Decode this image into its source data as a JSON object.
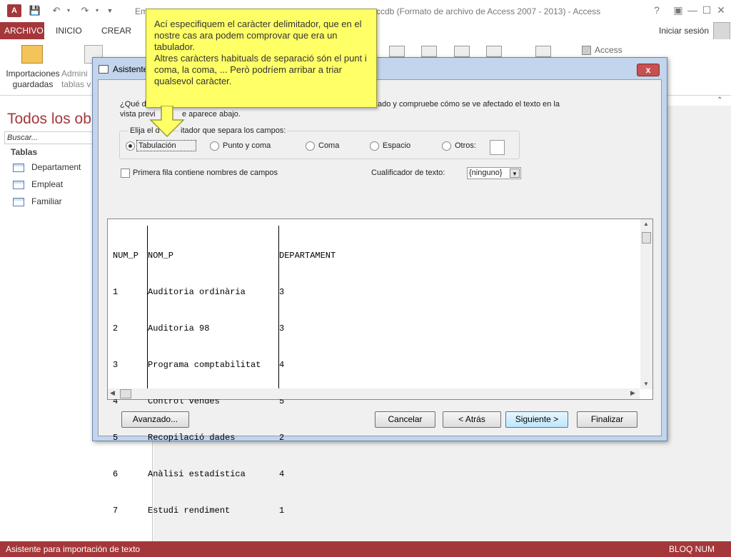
{
  "app": {
    "window_title_left": "Em",
    "window_title_right": "ccdb (Formato de archivo de Access 2007 - 2013) - Access",
    "help": "?",
    "signin": "Iniciar sesión"
  },
  "tabs": {
    "file": "ARCHIVO",
    "home": "INICIO",
    "create": "CREAR"
  },
  "ribbon": {
    "saved_imports_line1": "Importaciones",
    "saved_imports_line2": "guardadas",
    "linked_line1": "Admini",
    "linked_line2": "tablas v",
    "access_label": "Access"
  },
  "nav": {
    "header": "Todos los ob",
    "search_placeholder": "Buscar...",
    "group": "Tablas",
    "items": [
      "Departament",
      "Empleat",
      "Familiar"
    ]
  },
  "status": {
    "left": "Asistente para importación de texto",
    "right": "BLOQ NUM"
  },
  "dialog": {
    "title": "Asistente",
    "close": "x",
    "instr_left1": "¿Qué d",
    "instr_right1": "ado y compruebe cómo se ve afectado el texto en la",
    "instr_left2": "vista previ",
    "instr_right2": "e aparece abajo.",
    "group_label_left": "Elija el d",
    "group_label_right": "itador que separa los campos:",
    "delimiters": [
      "Tabulación",
      "Punto y coma",
      "Coma",
      "Espacio",
      "Otros:"
    ],
    "selected_delimiter": "Tabulación",
    "first_row_label": "Primera fila contiene nombres de campos",
    "qualifier_label": "Cualificador de texto:",
    "qualifier_value": "{ninguno}",
    "preview": {
      "headers": [
        "NUM_P",
        "NOM_P",
        "DEPARTAMENT"
      ],
      "rows": [
        [
          "1",
          "Auditoria ordinària",
          "3"
        ],
        [
          "2",
          "Auditoria 98",
          "3"
        ],
        [
          "3",
          "Programa comptabilitat",
          "4"
        ],
        [
          "4",
          "Control vendes",
          "5"
        ],
        [
          "5",
          "Recopilació dades",
          "2"
        ],
        [
          "6",
          "Anàlisi estadística",
          "4"
        ],
        [
          "7",
          "Estudi rendiment",
          "1"
        ]
      ]
    },
    "buttons": {
      "advanced": "Avanzado...",
      "cancel": "Cancelar",
      "back": "< Atrás",
      "next": "Siguiente >",
      "finish": "Finalizar"
    }
  },
  "callout": {
    "line1": "Ací especifiquem el caràcter delimitador, que en el nostre cas ara podem comprovar que era un tabulador.",
    "line2": "Altres caràcters habituals de separació són el punt i coma, la coma, ... Però podríem arribar a triar qualsevol caràcter."
  },
  "colors": {
    "accent": "#a4373a",
    "callout": "#ffff66"
  }
}
